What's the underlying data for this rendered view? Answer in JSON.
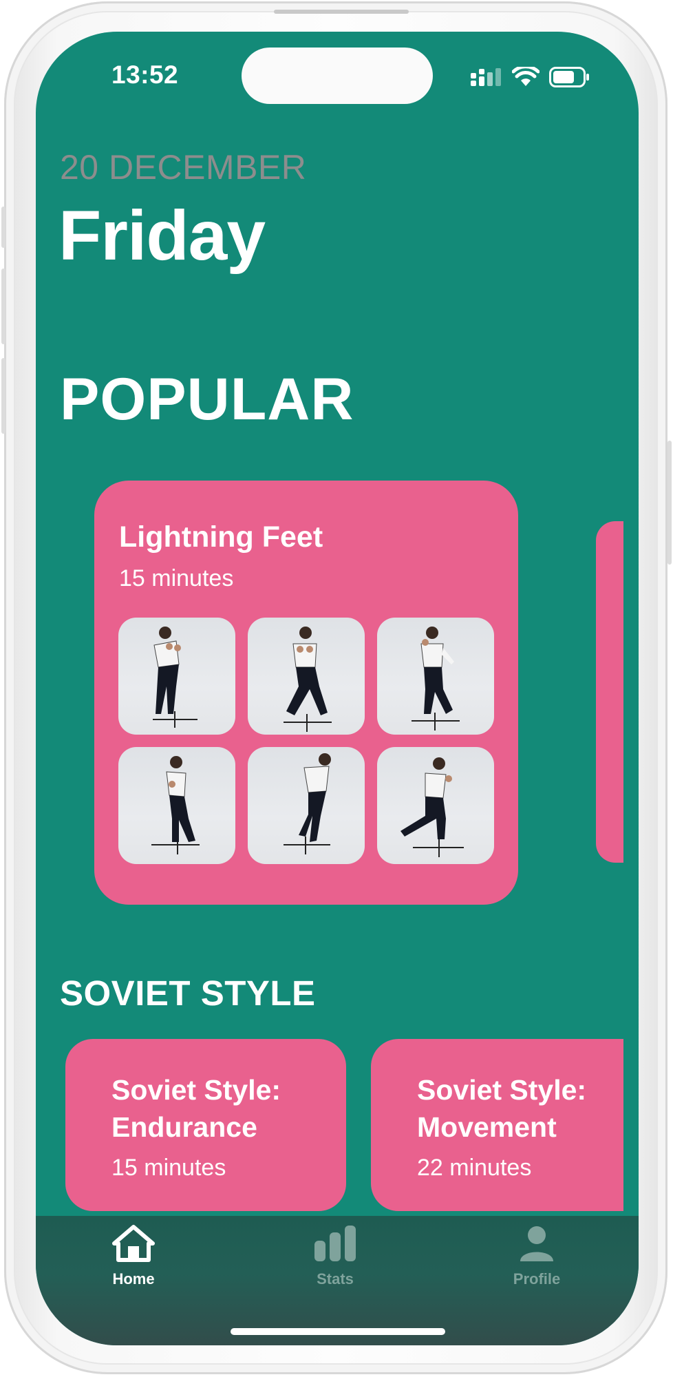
{
  "status_bar": {
    "time": "13:52"
  },
  "header": {
    "date": "20 DECEMBER",
    "day": "Friday"
  },
  "popular": {
    "heading": "POPULAR",
    "card": {
      "title": "Lightning Feet",
      "duration": "15 minutes",
      "thumbnails": [
        "boxer-pose-1",
        "boxer-pose-2",
        "boxer-pose-3",
        "boxer-pose-4",
        "boxer-pose-5",
        "boxer-pose-6"
      ]
    }
  },
  "soviet": {
    "heading": "SOVIET STYLE",
    "cards": [
      {
        "title": "Soviet Style: Endurance",
        "duration": "15 minutes"
      },
      {
        "title": "Soviet Style: Movement",
        "duration": "22 minutes"
      }
    ]
  },
  "tabbar": {
    "items": [
      {
        "label": "Home",
        "icon": "house-icon",
        "active": true
      },
      {
        "label": "Stats",
        "icon": "bar-chart-icon",
        "active": false
      },
      {
        "label": "Profile",
        "icon": "person-icon",
        "active": false
      }
    ]
  },
  "colors": {
    "background": "#138a78",
    "card": "#e9618e",
    "tabbar": "#235f56",
    "date_text": "#8d8d8d",
    "inactive_tab": "#7fa39c"
  }
}
